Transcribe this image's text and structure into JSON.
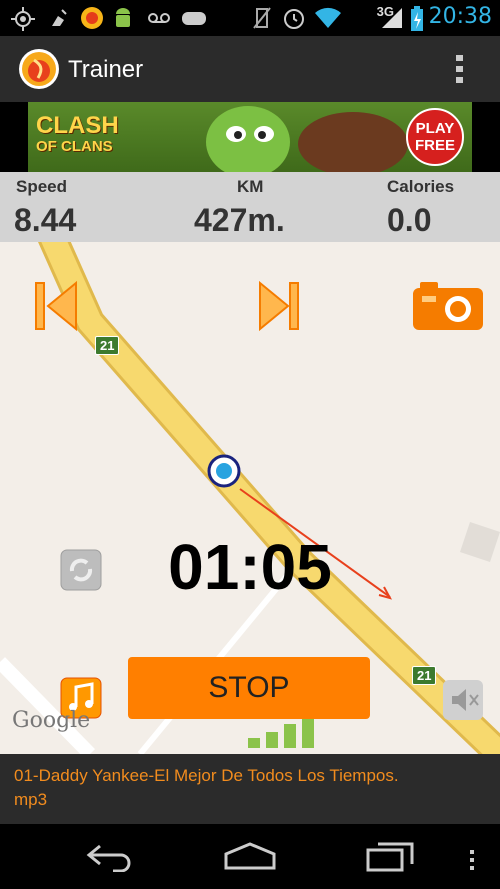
{
  "status_bar": {
    "time": "20:38",
    "network": "3G"
  },
  "app_bar": {
    "title": "Trainer"
  },
  "ad": {
    "brand_line1": "CLASH",
    "brand_line2": "OF CLANS",
    "cta_line1": "PLAY",
    "cta_line2": "FREE"
  },
  "stats": {
    "speed_label": "Speed",
    "speed_value": "8.44",
    "km_label": "KM",
    "km_value": "427m.",
    "calories_label": "Calories",
    "calories_value": "0.0"
  },
  "map": {
    "road_label_1": "21",
    "road_label_2": "21",
    "google_logo": "Google"
  },
  "timer": "01:05",
  "stop_button": "STOP",
  "now_playing": {
    "track": "01-Daddy Yankee-El Mejor De Todos Los Tiempos.\nmp3"
  },
  "colors": {
    "accent": "#ff7f00",
    "clock": "#33b5e5",
    "track": "#f28c1e"
  }
}
